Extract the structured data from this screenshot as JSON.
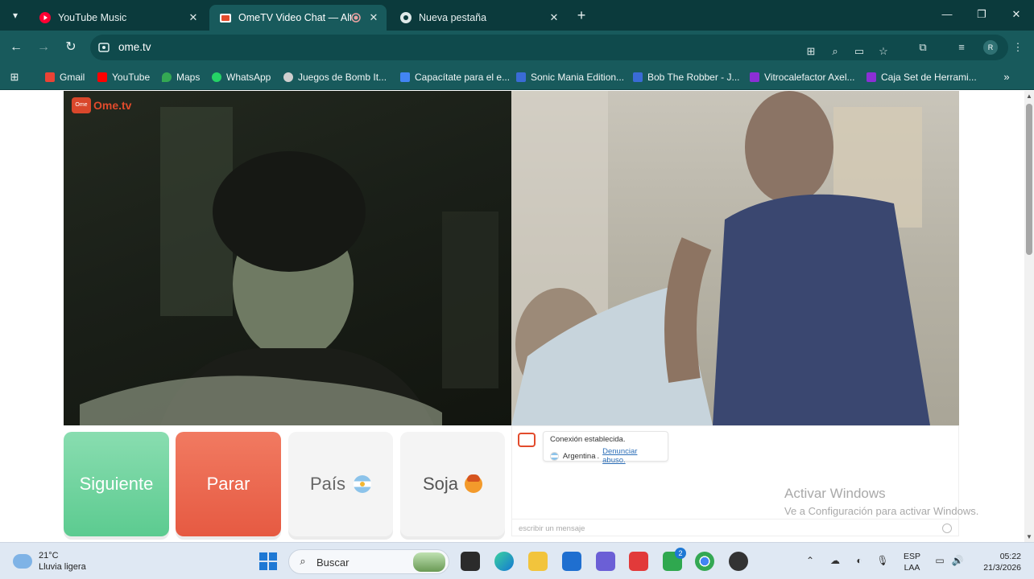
{
  "browser": {
    "tabs": [
      {
        "title": "YouTube Music",
        "favicon": "youtube-music-icon",
        "active": false
      },
      {
        "title": "OmeTV Video Chat — Alter",
        "favicon": "ometv-icon",
        "active": true,
        "recording": true
      },
      {
        "title": "Nueva pestaña",
        "favicon": "chrome-icon",
        "active": false
      }
    ],
    "address": "ome.tv",
    "bookmarks": [
      {
        "label": "Gmail",
        "icon": "gmail-icon"
      },
      {
        "label": "YouTube",
        "icon": "youtube-icon"
      },
      {
        "label": "Maps",
        "icon": "maps-icon"
      },
      {
        "label": "WhatsApp",
        "icon": "whatsapp-icon"
      },
      {
        "label": "Juegos de Bomb It...",
        "icon": "game-icon"
      },
      {
        "label": "Capacítate para el e...",
        "icon": "google-icon"
      },
      {
        "label": "Sonic Mania Edition...",
        "icon": "sonic-icon"
      },
      {
        "label": "Bob The Robber - J...",
        "icon": "game-icon"
      },
      {
        "label": "Vitrocalefactor Axel...",
        "icon": "shop-icon"
      },
      {
        "label": "Caja Set de Herrami...",
        "icon": "shop-icon"
      }
    ],
    "profile_initial": "R"
  },
  "ometv": {
    "logo_text": "Ome.tv",
    "buttons": {
      "next": "Siguiente",
      "stop": "Parar",
      "country": "País",
      "gender": "Soja"
    },
    "chat": {
      "status": "Conexión establecida.",
      "country": "Argentina",
      "separator": ".",
      "report": "Denunciar abuso.",
      "input_placeholder": "escribir un mensaje"
    }
  },
  "watermark": {
    "line1": "Activar Windows",
    "line2": "Ve a Configuración para activar Windows."
  },
  "taskbar": {
    "weather_temp": "21°C",
    "weather_desc": "Lluvia ligera",
    "search_label": "Buscar",
    "lang_line1": "ESP",
    "lang_line2": "LAA",
    "time": "05:22",
    "date": "21/3/2026",
    "badge_count": "2"
  },
  "colors": {
    "titlebar": "#0b3a3c",
    "toolbar": "#185a5c",
    "next_button": "#5ccb90",
    "stop_button": "#e65a42",
    "ometv_brand": "#e24b2c"
  }
}
